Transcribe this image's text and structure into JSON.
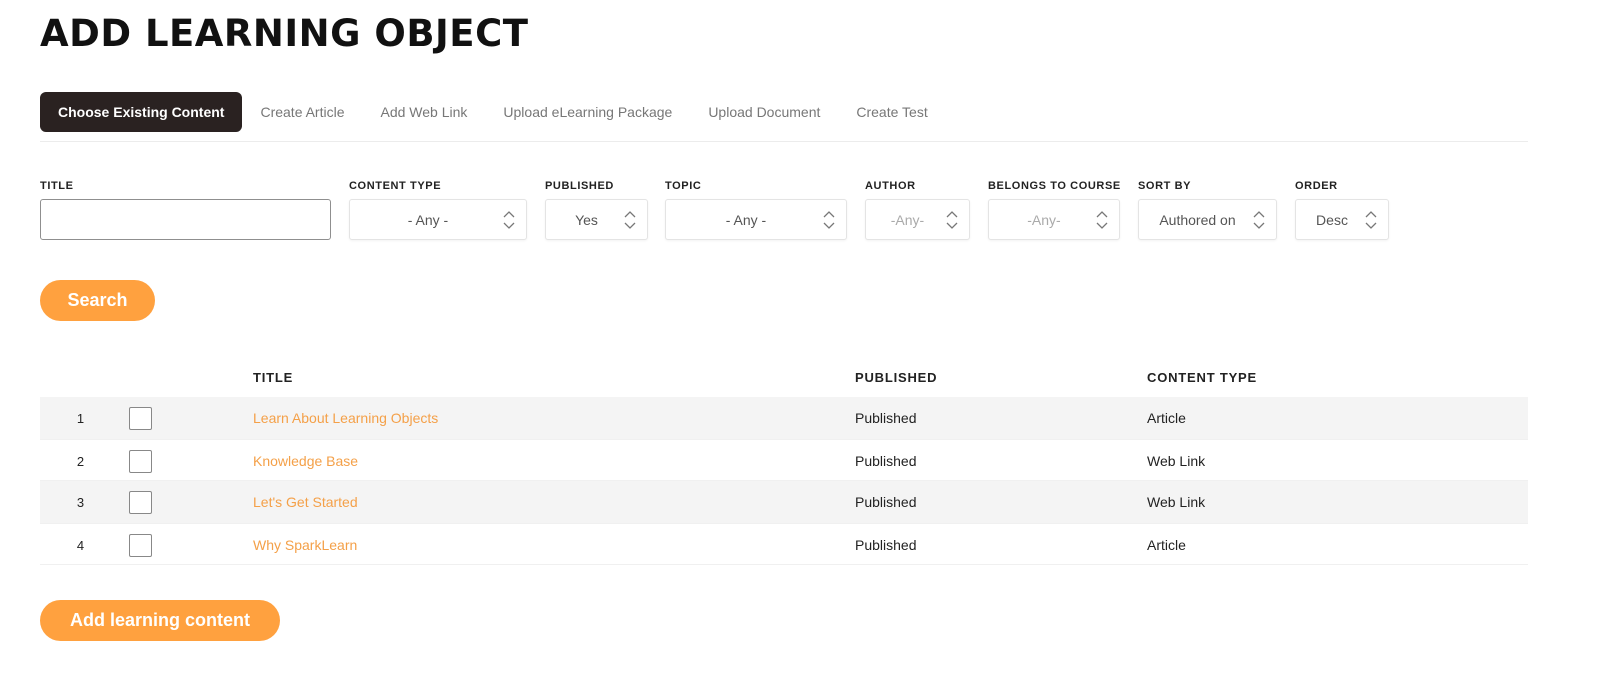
{
  "page": {
    "title": "ADD LEARNING OBJECT"
  },
  "tabs": [
    {
      "label": "Choose Existing Content",
      "active": true
    },
    {
      "label": "Create Article",
      "active": false
    },
    {
      "label": "Add Web Link",
      "active": false
    },
    {
      "label": "Upload eLearning Package",
      "active": false
    },
    {
      "label": "Upload Document",
      "active": false
    },
    {
      "label": "Create Test",
      "active": false
    }
  ],
  "filters": {
    "title": {
      "label": "TITLE",
      "value": ""
    },
    "content_type": {
      "label": "CONTENT TYPE",
      "value": "- Any -"
    },
    "published": {
      "label": "PUBLISHED",
      "value": "Yes"
    },
    "topic": {
      "label": "TOPIC",
      "value": "- Any -"
    },
    "author": {
      "label": "AUTHOR",
      "value": "-Any-"
    },
    "belongs_to_course": {
      "label": "BELONGS TO COURSE",
      "value": "-Any-"
    },
    "sort_by": {
      "label": "SORT BY",
      "value": "Authored on"
    },
    "order": {
      "label": "ORDER",
      "value": "Desc"
    }
  },
  "search_button": {
    "label": "Search"
  },
  "table": {
    "columns": {
      "title": "TITLE",
      "published": "PUBLISHED",
      "content_type": "CONTENT TYPE"
    },
    "rows": [
      {
        "num": "1",
        "title": "Learn About Learning Objects",
        "published": "Published",
        "content_type": "Article"
      },
      {
        "num": "2",
        "title": "Knowledge Base",
        "published": "Published",
        "content_type": "Web Link"
      },
      {
        "num": "3",
        "title": "Let's Get Started",
        "published": "Published",
        "content_type": "Web Link"
      },
      {
        "num": "4",
        "title": "Why SparkLearn",
        "published": "Published",
        "content_type": "Article"
      }
    ]
  },
  "add_button": {
    "label": "Add learning content"
  },
  "colors": {
    "accent": "#ffa13f",
    "link": "#f4a048",
    "active_tab": "#2a2221"
  },
  "icons": {
    "select_arrows": "chevron-up-down-icon"
  }
}
